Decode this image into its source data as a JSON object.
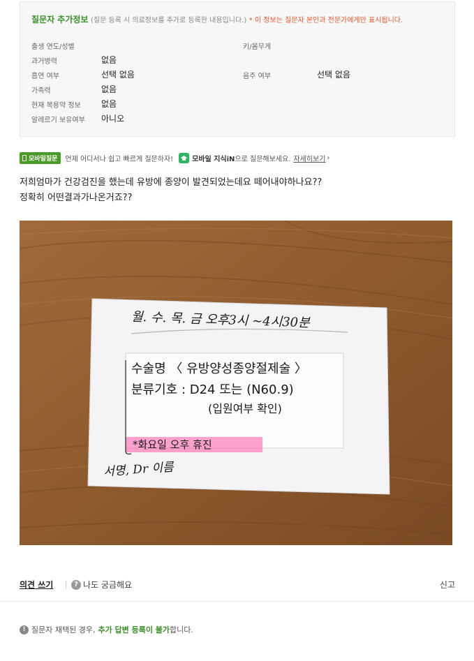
{
  "info": {
    "title": "질문자 추가정보",
    "desc": "(질문 등록 시 의료정보를 추가로 등록한 내용입니다.)",
    "warn": "* 이 정보는 질문자 본인과 전문가에게만 표시됩니다.",
    "rows": [
      {
        "label": "출생 연도/성별",
        "value": ""
      },
      {
        "label": "과거병력",
        "value": "없음"
      },
      {
        "label": "흡연 여부",
        "value": "선택 없음"
      },
      {
        "label": "가족력",
        "value": "없음"
      },
      {
        "label": "현재 복용약 정보",
        "value": "없음"
      },
      {
        "label": "알레르기 보유여부",
        "value": "아니오"
      }
    ],
    "right_rows": [
      {
        "label": "키/몸무게",
        "value": ""
      },
      {
        "label": "음주 여부",
        "value": "선택 없음"
      }
    ]
  },
  "promo": {
    "badge": "모바일질문",
    "text": "언제 어디서나 쉽고 빠르게 질문하자!",
    "service": "모바일 지식iN",
    "service_suffix": "으로 질문해보세요.",
    "link": "자세히보기",
    "chevron": "›"
  },
  "question": {
    "line1": "저희엄마가 건강검진을 했는데 유방에 종양이 발견되었는데요 떼어내야하나요??",
    "line2": "정확히 어떤결과가나온거죠??"
  },
  "photo": {
    "line1": "월. 수. 목. 금 오후3시 ~4시30분",
    "line2": "수술명 〈 유방양성종양절제술 〉",
    "line3": "분류기호 : D24 또는 (N60.9)",
    "line4": "(입원여부 확인)",
    "line5": "*화요일 오후 휴진",
    "line6": "서명, Dr 이름"
  },
  "actions": {
    "write": "의견 쓰기",
    "curious": "나도 궁금해요",
    "report": "신고"
  },
  "notice": {
    "prefix": "질문자 채택된 경우,",
    "highlight": "추가 답변 등록이 불가",
    "suffix": "합니다."
  },
  "colors": {
    "green": "#3b8e29",
    "warn": "#e4572e",
    "wood": "#8b5a2b"
  }
}
